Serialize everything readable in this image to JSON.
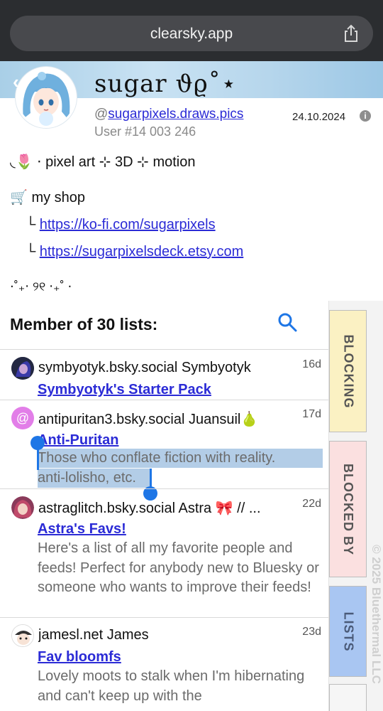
{
  "browser": {
    "url": "clearsky.app",
    "share_icon": "share-icon"
  },
  "profile": {
    "display_name": "sugar ϑϱ˚⋆",
    "handle_prefix": "@",
    "handle": "sugarpixels.draws.pics",
    "user_number": "User #14 003 246",
    "date": "24.10.2024",
    "info_glyph": "i"
  },
  "bio": {
    "line1": "◟🌷 ⋅ pixel art ⊹ 3D ⊹ motion",
    "line2": "🛒 my shop",
    "arrow": "└",
    "link1": "https://ko-fi.com/sugarpixels",
    "link2": "https://sugarpixelsdeck.etsy.com",
    "line5": "⋅˚₊‧ ୨୧ ‧₊˚ ⋅"
  },
  "lists": {
    "header": "Member of 30 lists:",
    "items": [
      {
        "title": "symbyotyk.bsky.social Symbyotyk",
        "age": "16d",
        "name": "Symbyotyk's Starter Pack",
        "desc": ""
      },
      {
        "title": "antipuritan3.bsky.social Juansuil🍐",
        "age": "17d",
        "name": "Anti-Puritan",
        "desc1": "Those who conflate fiction with reality.",
        "desc2": "anti-lolisho, etc.",
        "avatar_glyph": "@"
      },
      {
        "title": "astraglitch.bsky.social Astra 🎀 // ...",
        "age": "22d",
        "name": "Astra's Favs!",
        "desc": "Here's a list of all my favorite people and feeds! Perfect for anybody new to Bluesky or someone who wants to improve their feeds!"
      },
      {
        "title": "jamesl.net James",
        "age": "23d",
        "name": "Fav bloomfs",
        "desc": "Lovely moots to stalk when I'm hibernating and can't keep up with the"
      }
    ]
  },
  "tabs": {
    "blocking": "BLOCKING",
    "blocked_by": "BLOCKED BY",
    "lists": "LISTS",
    "copyright": "© 2025 Bluethermal LLC"
  },
  "colors": {
    "link": "#2b2bd6",
    "blocking_tab": "#fbf1c3",
    "blocked_by_tab": "#fbe0e0",
    "lists_tab": "#a9c6f2",
    "selection": "#b3cde7",
    "selection_handle": "#1e76e6"
  }
}
